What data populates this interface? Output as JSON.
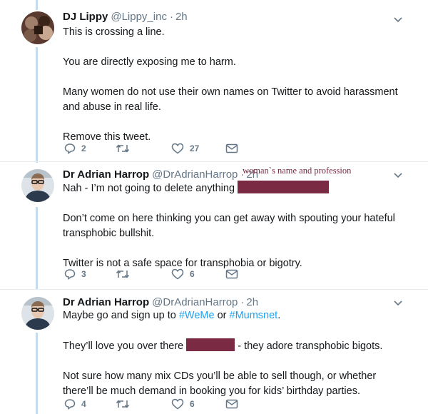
{
  "tweets": [
    {
      "name": "DJ Lippy",
      "handle": "@Lippy_inc",
      "time": "2h",
      "lines": [
        "This is crossing a line.",
        "You are directly exposing me to harm.",
        "Many women do not use their own names on Twitter to avoid harassment and abuse in real life.",
        "Remove this tweet."
      ],
      "replies": "2",
      "retweets": "",
      "likes": "27"
    },
    {
      "name": "Dr Adrian Harrop",
      "handle": "@DrAdrianHarrop",
      "time": "2h",
      "annotation": "woman`s name and profession",
      "line1": "Nah - I’m not going to delete anything",
      "lines": [
        "Don’t come on here thinking you can get away with spouting your hateful transphobic bullshit.",
        "Twitter is not a safe space for transphobia or bigotry."
      ],
      "replies": "3",
      "retweets": "",
      "likes": "6"
    },
    {
      "name": "Dr Adrian Harrop",
      "handle": "@DrAdrianHarrop",
      "time": "2h",
      "line1_pre": "Maybe go and sign up to ",
      "hashtag1": "#WeMe",
      "line1_mid": " or ",
      "hashtag2": "#Mumsnet",
      "line1_post": ".",
      "line2_pre": "They’ll love you over there",
      "line2_post": " - they adore transphobic bigots.",
      "line3": "Not sure how many mix CDs you’ll be able to sell though, or whether there’ll be much demand in booking you for kids’ birthday parties.",
      "replies": "4",
      "retweets": "",
      "likes": "6"
    }
  ],
  "separator": "·",
  "colors": {
    "thread_line": "#c4dcee",
    "redaction": "#7a2a42",
    "hashtag": "#1da1f2",
    "secondary_text": "#657786"
  },
  "icons": [
    "caret-down-icon",
    "reply-icon",
    "retweet-icon",
    "like-icon",
    "direct-message-icon"
  ]
}
